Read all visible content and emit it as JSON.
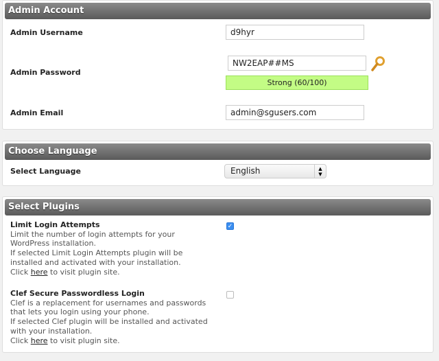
{
  "admin_account": {
    "title": "Admin Account",
    "username": {
      "label": "Admin Username",
      "value": "d9hyr"
    },
    "password": {
      "label": "Admin Password",
      "value": "NW2EAP##MS",
      "strength_text": "Strong (60/100)",
      "strength_score": 60,
      "strength_max": 100,
      "strength_color": "#c3fc85",
      "key_icon": "key-icon"
    },
    "email": {
      "label": "Admin Email",
      "value": "admin@sgusers.com"
    }
  },
  "language": {
    "title": "Choose Language",
    "label": "Select Language",
    "selected": "English"
  },
  "plugins": {
    "title": "Select Plugins",
    "items": [
      {
        "name": "Limit Login Attempts",
        "lines": [
          "Limit the number of login attempts for your",
          "WordPress installation.",
          "If selected Limit Login Attempts plugin will be",
          "installed and activated with your installation."
        ],
        "click": "Click",
        "link": "here",
        "after": "to visit plugin site.",
        "checked": true
      },
      {
        "name": "Clef Secure Passwordless Login",
        "lines": [
          "Clef is a replacement for usernames and passwords",
          "that lets you login using your phone.",
          "If selected Clef plugin will be installed and activated",
          "with your installation."
        ],
        "click": "Click",
        "link": "here",
        "after": "to visit plugin site.",
        "checked": false
      }
    ]
  }
}
